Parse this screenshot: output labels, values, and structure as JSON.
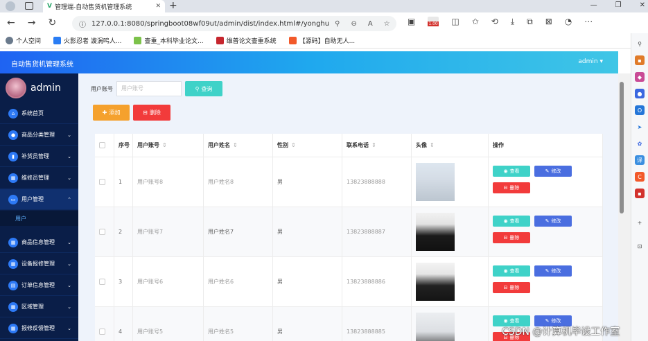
{
  "browser": {
    "tab_title": "管理端-自动售货机管理系统",
    "url": "127.0.0.1:8080/springboot08wf09ut/admin/dist/index.html#/yonghu",
    "badge": "1.00",
    "bookmarks": [
      {
        "label": "个人空间",
        "color": "#6a7a8c"
      },
      {
        "label": "火影忍者 漩涡鸣人...",
        "color": "#2a7df4"
      },
      {
        "label": "查重_本科毕业论文...",
        "color": "#7cc24a"
      },
      {
        "label": "维普论文查重系统",
        "color": "#c6262e"
      },
      {
        "label": "【源码】自助无人...",
        "color": "#f2592a"
      }
    ]
  },
  "app": {
    "title": "自动售货机管理系统",
    "user_menu": "admin ▾",
    "profile_name": "admin"
  },
  "sidebar": {
    "items": [
      {
        "label": "系统首页",
        "icon": "home-icon",
        "glyph": "⌂",
        "has_children": false
      },
      {
        "label": "商品分类管理",
        "icon": "user-icon",
        "glyph": "●",
        "has_children": true
      },
      {
        "label": "补货员管理",
        "icon": "chart-icon",
        "glyph": "▮",
        "has_children": true
      },
      {
        "label": "维修员管理",
        "icon": "grid-icon",
        "glyph": "▦",
        "has_children": true
      },
      {
        "label": "用户管理",
        "icon": "folder-icon",
        "glyph": "▭",
        "has_children": true,
        "expanded": true
      },
      {
        "label": "商品信息管理",
        "icon": "grid-icon",
        "glyph": "▦",
        "has_children": true
      },
      {
        "label": "设备报修管理",
        "icon": "grid-icon",
        "glyph": "▦",
        "has_children": true
      },
      {
        "label": "订单信息管理",
        "icon": "doc-icon",
        "glyph": "▤",
        "has_children": true
      },
      {
        "label": "区域管理",
        "icon": "grid-icon",
        "glyph": "▦",
        "has_children": true
      },
      {
        "label": "报修反馈管理",
        "icon": "grid-icon",
        "glyph": "▦",
        "has_children": true
      }
    ],
    "sub_item": "用户"
  },
  "search": {
    "label": "用户账号",
    "placeholder": "用户账号",
    "button": "查询"
  },
  "actions": {
    "add": "添加",
    "delete": "删除"
  },
  "table": {
    "headers": {
      "index": "序号",
      "account": "用户账号",
      "name": "用户姓名",
      "gender": "性别",
      "phone": "联系电话",
      "avatar": "头像",
      "ops": "操作"
    },
    "sort_glyph": "⇕",
    "view_label": "查看",
    "edit_label": "修改",
    "delete_label": "删除",
    "rows": [
      {
        "index": "1",
        "account": "用户账号8",
        "name": "用户姓名8",
        "gender": "男",
        "phone": "13823888888"
      },
      {
        "index": "2",
        "account": "用户账号7",
        "name": "用户姓名7",
        "gender": "男",
        "phone": "13823888887"
      },
      {
        "index": "3",
        "account": "用户账号6",
        "name": "用户姓名6",
        "gender": "男",
        "phone": "13823888886"
      },
      {
        "index": "4",
        "account": "用户账号5",
        "name": "用户姓名5",
        "gender": "男",
        "phone": "13823888885"
      }
    ]
  },
  "watermark": "CSDN @计算机毕设工作室"
}
